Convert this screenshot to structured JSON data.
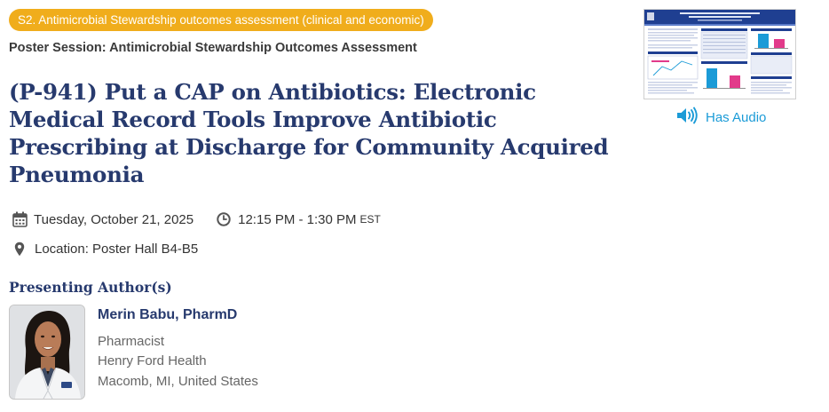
{
  "track_badge": "S2. Antimicrobial Stewardship outcomes assessment (clinical and economic)",
  "session_name": "Poster Session: Antimicrobial Stewardship Outcomes Assessment",
  "title": "(P-941) Put a CAP on Antibiotics: Electronic Medical Record Tools Improve Antibiotic Prescribing at Discharge for Community Acquired Pneumonia",
  "date": "Tuesday, October 21, 2025",
  "time": "12:15 PM - 1:30 PM",
  "timezone": "EST",
  "location": "Location: Poster Hall B4-B5",
  "presenting_heading": "Presenting Author(s)",
  "author": {
    "name": "Merin Babu, PharmD",
    "role": "Pharmacist",
    "organization": "Henry Ford Health",
    "location": "Macomb, MI, United States"
  },
  "audio_label": "Has Audio",
  "icons": {
    "date": "calendar-icon",
    "time": "clock-icon",
    "location": "map-pin-icon",
    "audio": "speaker-icon"
  },
  "colors": {
    "badge": "#f0ad1c",
    "title": "#273a6e",
    "audio": "#1b9bd7"
  }
}
